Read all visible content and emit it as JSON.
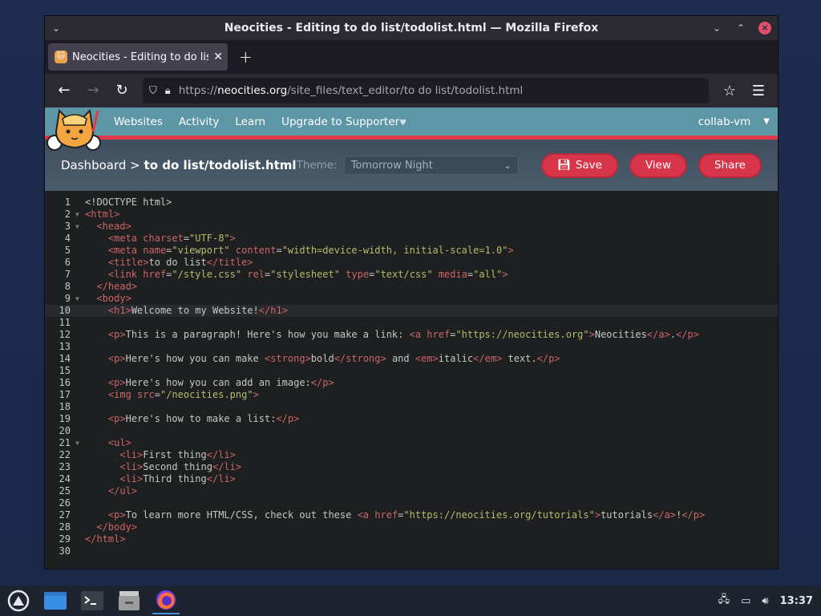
{
  "window": {
    "title": "Neocities - Editing to do list/todolist.html — Mozilla Firefox"
  },
  "tab": {
    "label": "Neocities - Editing to do list/t"
  },
  "url": {
    "prefix": "https://",
    "domain": "neocities.org",
    "path": "/site_files/text_editor/to do list/todolist.html"
  },
  "nav": {
    "items": [
      "Websites",
      "Activity",
      "Learn",
      "Upgrade to Supporter"
    ],
    "user": "collab-vm"
  },
  "editor": {
    "breadcrumb_root": "Dashboard",
    "breadcrumb_sep": ">",
    "breadcrumb_file": "to do list/todolist.html",
    "theme_label": "Theme:",
    "theme_value": "Tomorrow Night",
    "save_label": "Save",
    "view_label": "View",
    "share_label": "Share"
  },
  "code_lines": [
    "<!DOCTYPE html>",
    "<html>",
    "  <head>",
    "    <meta charset=\"UTF-8\">",
    "    <meta name=\"viewport\" content=\"width=device-width, initial-scale=1.0\">",
    "    <title>to do list</title>",
    "    <link href=\"/style.css\" rel=\"stylesheet\" type=\"text/css\" media=\"all\">",
    "  </head>",
    "  <body>",
    "    <h1>Welcome to my Website!</h1>",
    "",
    "    <p>This is a paragraph! Here's how you make a link: <a href=\"https://neocities.org\">Neocities</a>.</p>",
    "",
    "    <p>Here's how you can make <strong>bold</strong> and <em>italic</em> text.</p>",
    "",
    "    <p>Here's how you can add an image:</p>",
    "    <img src=\"/neocities.png\">",
    "",
    "    <p>Here's how to make a list:</p>",
    "",
    "    <ul>",
    "      <li>First thing</li>",
    "      <li>Second thing</li>",
    "      <li>Third thing</li>",
    "    </ul>",
    "",
    "    <p>To learn more HTML/CSS, check out these <a href=\"https://neocities.org/tutorials\">tutorials</a>!</p>",
    "  </body>",
    "</html>",
    ""
  ],
  "fold_lines": [
    2,
    3,
    9,
    21
  ],
  "active_line": 10,
  "taskbar": {
    "clock": "13:37"
  },
  "colors": {
    "accent": "#d8344a",
    "nc_header": "#5d97a5",
    "editor_bg": "#1d1f21"
  }
}
